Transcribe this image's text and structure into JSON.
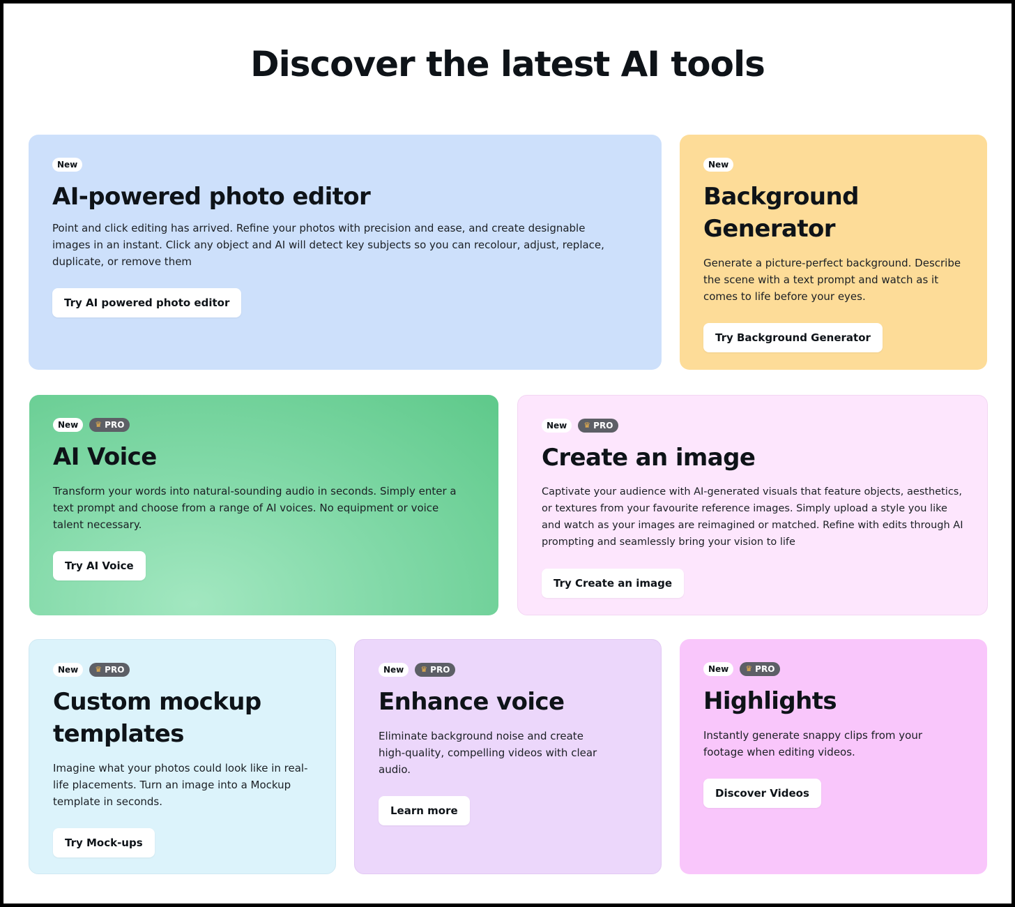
{
  "page": {
    "title": "Discover the latest AI tools"
  },
  "badges": {
    "new": "New",
    "pro": "PRO"
  },
  "cards": [
    {
      "title": "AI-powered photo editor",
      "description": "Point and click editing has arrived. Refine your photos with precision and ease, and create designable images in an instant. Click any object and AI will detect key subjects so you can recolour, adjust, replace, duplicate, or remove them",
      "button": "Try AI powered photo editor",
      "badges": [
        "new"
      ],
      "color": "#cde0fb"
    },
    {
      "title": "Background Generator",
      "description": "Generate a picture-perfect background. Describe the scene with a text prompt and watch as it comes to life before your eyes.",
      "button": "Try Background Generator",
      "badges": [
        "new"
      ],
      "color": "#fddc98"
    },
    {
      "title": "AI Voice",
      "description": "Transform your words into natural-sounding audio in seconds. Simply enter a text prompt and choose from a range of AI voices. No equipment or voice talent necessary.",
      "button": "Try AI Voice",
      "badges": [
        "new",
        "pro"
      ],
      "color": "#6fd197"
    },
    {
      "title": "Create an image",
      "description": "Captivate your audience with AI-generated visuals that feature objects, aesthetics, or textures from your favourite reference images. Simply upload a style you like and watch as your images are reimagined or matched. Refine with edits through AI prompting and seamlessly bring your vision to life",
      "button": "Try Create an image",
      "badges": [
        "new",
        "pro"
      ],
      "color": "#fde6fd"
    },
    {
      "title": "Custom mockup templates",
      "description": "Imagine what your photos could look like in real-life placements. Turn an image into a Mockup template in seconds.",
      "button": "Try Mock-ups",
      "badges": [
        "new",
        "pro"
      ],
      "color": "#dcf3fb"
    },
    {
      "title": "Enhance voice",
      "description": "Eliminate background noise and create high-quality, compelling videos with clear audio.",
      "button": "Learn more",
      "badges": [
        "new",
        "pro"
      ],
      "color": "#ecd7fb"
    },
    {
      "title": "Highlights",
      "description": "Instantly generate snappy clips from your footage when editing videos.",
      "button": "Discover Videos",
      "badges": [
        "new",
        "pro"
      ],
      "color": "#f9c6fb"
    }
  ],
  "icons": {
    "pro_badge": "crown-icon"
  }
}
